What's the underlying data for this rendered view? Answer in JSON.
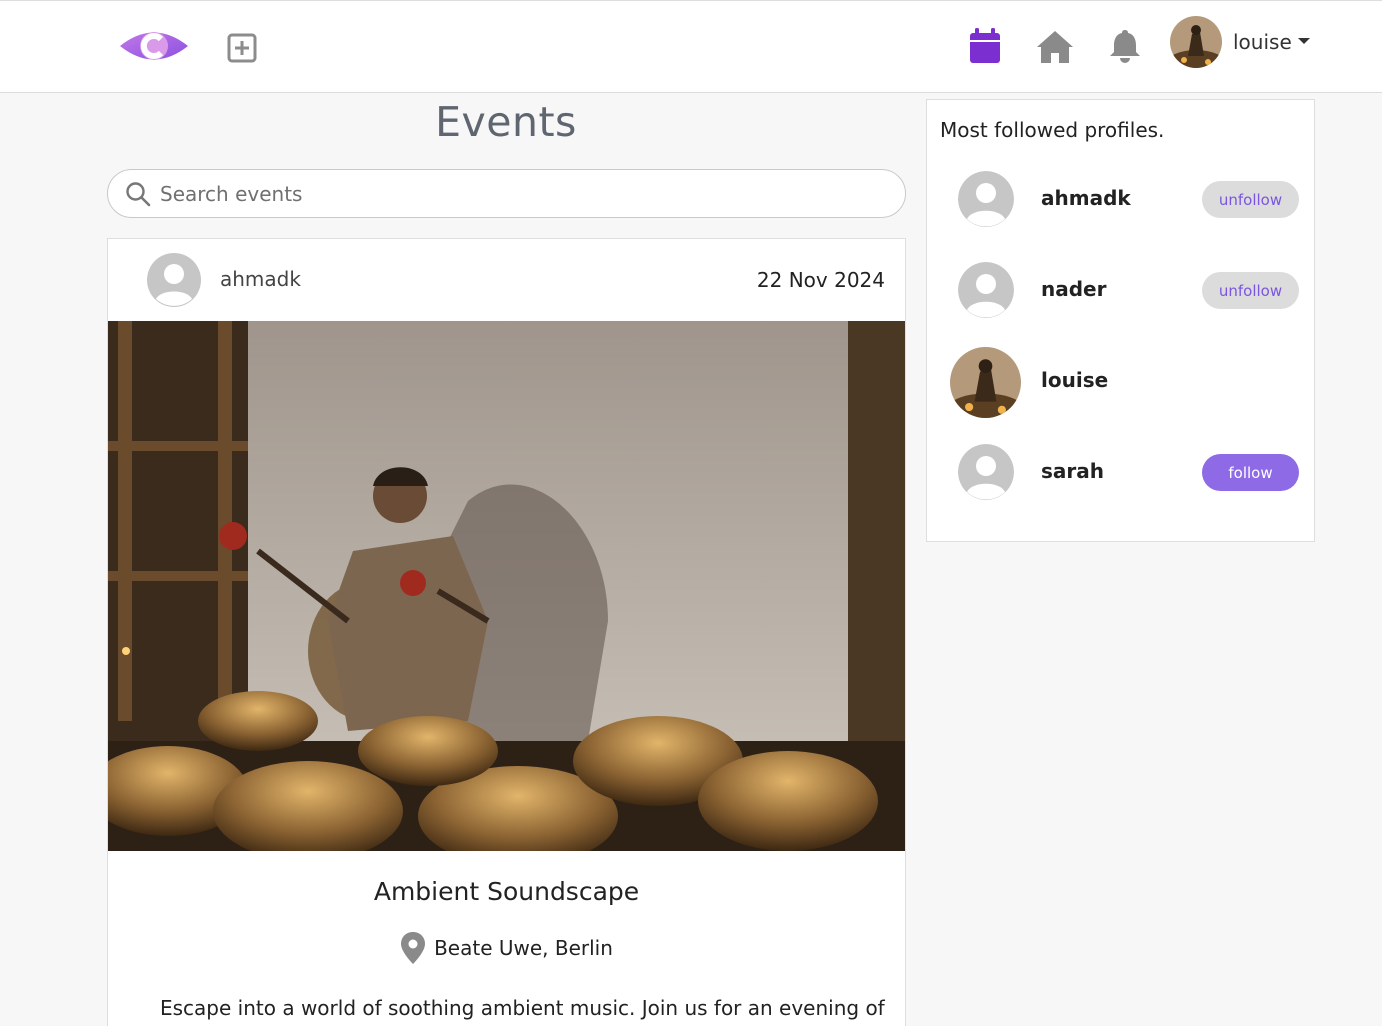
{
  "navbar": {
    "user_name": "louise",
    "colors": {
      "accent": "#7b2fd1",
      "icon_gray": "#8a8a8a"
    },
    "icons": [
      "logo-icon",
      "add-post-icon",
      "calendar-icon",
      "home-icon",
      "bell-icon",
      "caret-down-icon"
    ]
  },
  "page": {
    "title": "Events"
  },
  "search": {
    "placeholder": "Search events",
    "value": ""
  },
  "event": {
    "author": "ahmadk",
    "date": "22 Nov 2024",
    "title": "Ambient Soundscape",
    "location": "Beate Uwe, Berlin",
    "description": "Escape into a world of soothing ambient music. Join us for an evening of"
  },
  "profiles_panel": {
    "title": "Most followed profiles.",
    "profiles": [
      {
        "name": "ahmadk",
        "button": "unfollow",
        "avatar": "default"
      },
      {
        "name": "nader",
        "button": "unfollow",
        "avatar": "default"
      },
      {
        "name": "louise",
        "button": "",
        "avatar": "photo"
      },
      {
        "name": "sarah",
        "button": "follow",
        "avatar": "default"
      }
    ]
  }
}
